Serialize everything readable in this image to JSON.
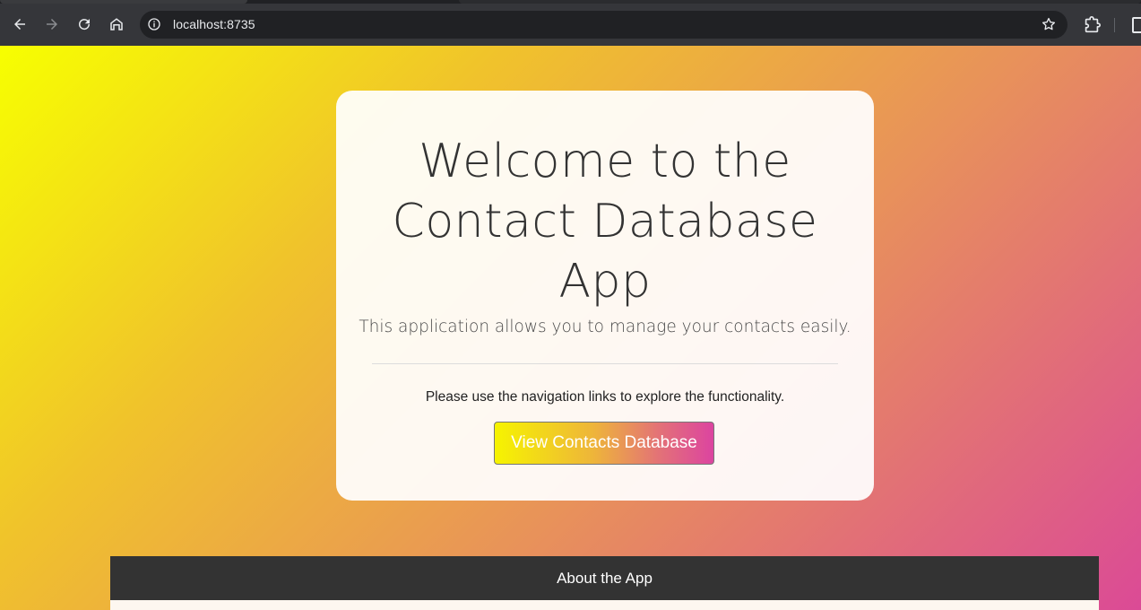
{
  "browser": {
    "url": "localhost:8735",
    "icons": {
      "back": "back-arrow-icon",
      "forward": "forward-arrow-icon",
      "reload": "reload-icon",
      "home": "home-icon",
      "site_info": "info-icon",
      "bookmark": "star-icon",
      "extensions": "puzzle-icon",
      "side_panel": "side-panel-icon"
    }
  },
  "hero": {
    "title_lines": [
      "Welcome to the",
      "Contact Database",
      "App"
    ],
    "lead": "This application allows you to manage your contacts easily.",
    "note": "Please use the navigation links to explore the functionality.",
    "cta_label": "View Contacts Database"
  },
  "about": {
    "header": "About the App"
  },
  "colors": {
    "gradient_start": "#f7ff00",
    "gradient_mid": "#e8925a",
    "gradient_end": "#db4a96",
    "about_header_bg": "#333333"
  }
}
